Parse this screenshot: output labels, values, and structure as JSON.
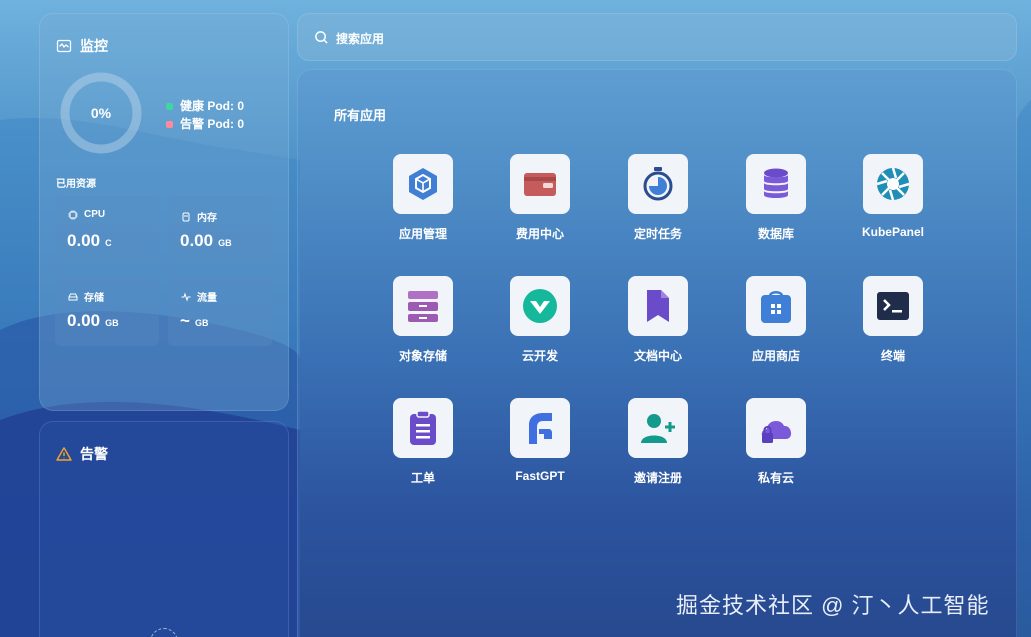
{
  "monitor": {
    "title": "监控",
    "ring_label": "0%",
    "health_pct": 0,
    "legend": [
      {
        "label": "健康 Pod: 0",
        "color": "#3ed6a1"
      },
      {
        "label": "告警 Pod: 0",
        "color": "#ff8a9a"
      }
    ],
    "resources_title": "已用资源",
    "cards": [
      {
        "name": "CPU",
        "value": "0.00",
        "unit": "C",
        "icon": "cpu-icon"
      },
      {
        "name": "内存",
        "value": "0.00",
        "unit": "GB",
        "icon": "memory-icon"
      },
      {
        "name": "存储",
        "value": "0.00",
        "unit": "GB",
        "icon": "storage-icon"
      },
      {
        "name": "流量",
        "value": "~",
        "unit": "GB",
        "icon": "traffic-icon"
      }
    ]
  },
  "alert": {
    "title": "告警"
  },
  "search": {
    "placeholder": "搜索应用"
  },
  "apps": {
    "title": "所有应用",
    "items": [
      {
        "label": "应用管理",
        "icon": "app-manage-icon"
      },
      {
        "label": "费用中心",
        "icon": "wallet-icon"
      },
      {
        "label": "定时任务",
        "icon": "timer-icon"
      },
      {
        "label": "数据库",
        "icon": "database-icon"
      },
      {
        "label": "KubePanel",
        "icon": "kubepanel-icon"
      },
      {
        "label": "对象存储",
        "icon": "object-storage-icon"
      },
      {
        "label": "云开发",
        "icon": "cloud-dev-icon"
      },
      {
        "label": "文档中心",
        "icon": "docs-icon"
      },
      {
        "label": "应用商店",
        "icon": "app-store-icon"
      },
      {
        "label": "终端",
        "icon": "terminal-icon"
      },
      {
        "label": "工单",
        "icon": "ticket-icon"
      },
      {
        "label": "FastGPT",
        "icon": "fastgpt-icon"
      },
      {
        "label": "邀请注册",
        "icon": "invite-icon"
      },
      {
        "label": "私有云",
        "icon": "private-cloud-icon"
      }
    ]
  },
  "watermark": "掘金技术社区 @ 汀丶人工智能"
}
